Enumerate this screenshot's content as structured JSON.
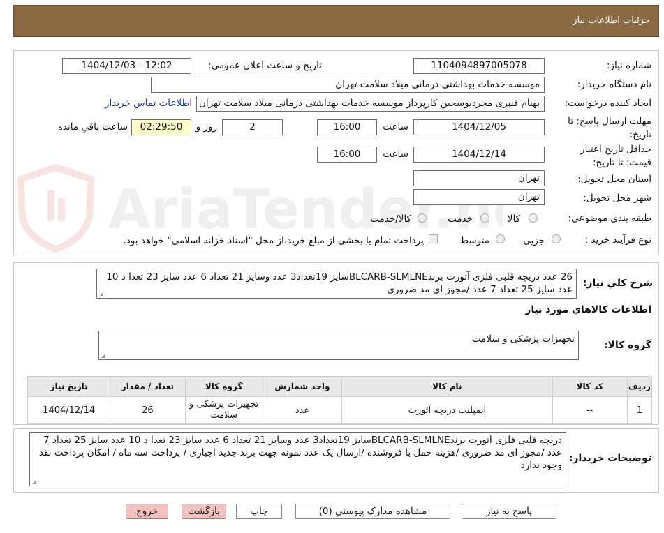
{
  "header": {
    "title": "جزئیات اطلاعات نیاز"
  },
  "form": {
    "need_number_label": "شماره نیاز:",
    "need_number": "1104094897005078",
    "announce_label": "تاریخ و ساعت اعلان عمومی:",
    "announce_value": "1404/12/03 - 12:02",
    "buyer_org_label": "نام دستگاه خریدار:",
    "buyer_org": "موسسه خدمات بهداشتی درمانی میلاد سلامت تهران",
    "creator_label": "ایجاد کننده درخواست:",
    "creator": "بهنام قنبری مجردبوسجین کارپرداز موسسه خدمات بهداشتی درمانی میلاد سلامت تهران",
    "contact_link": "اطلاعات تماس خریدار",
    "deadline_label": "مهلت ارسال پاسخ: تا تاریخ:",
    "deadline_date": "1404/12/05",
    "time_label": "ساعت",
    "deadline_time": "16:00",
    "days_value": "2",
    "days_label": "روز و",
    "remaining_time": "02:29:50",
    "remaining_label": "ساعت باقي مانده",
    "validity_label": "حداقل تاریخ اعتبار قیمت: تا تاریخ:",
    "validity_date": "1404/12/14",
    "validity_time": "16:00",
    "province_label": "استان محل تحویل:",
    "province": "تهران",
    "city_label": "شهر محل تحویل:",
    "city": "تهران",
    "category_label": "طبقه بندی موضوعی:",
    "category_options": [
      "کالا",
      "خدمت",
      "کالا/خدمت"
    ],
    "process_label": "نوع فرآیند خرید :",
    "process_options": [
      "جزیی",
      "متوسط"
    ],
    "treasury_note": "پرداخت تمام یا بخشی از مبلغ خرید،از محل \"اسناد خزانه اسلامی\" خواهد بود."
  },
  "summary": {
    "label": "شرح کلي نياز:",
    "text": "26 عدد دریچه قلبی فلزی  آتورت برندBLCARB-SLMLNEسایز  19تعداد3 عدد وسایز 21 تعداد 6  عدد سایز 23 تعدا د 10 عدد سایز 25 تعداد 7 عدد /مجوز ای مد ضروری"
  },
  "goods": {
    "section_title": "اطلاعات کالاهاي مورد نياز",
    "group_label": "گروه کالا:",
    "group_value": "تجهیزات پزشکی و سلامت"
  },
  "table": {
    "headers": [
      "رديف",
      "کد کالا",
      "نام کالا",
      "واحد شمارش",
      "گروه کالا",
      "تعداد / مقدار",
      "تاریخ نیاز"
    ],
    "rows": [
      [
        "1",
        "--",
        "ایمپلنت دریچه آئورت",
        "عدد",
        "تجهیزات پزشکی و سلامت",
        "26",
        "1404/12/14"
      ]
    ]
  },
  "buyer_notes": {
    "label": "توضیحات خریدار:",
    "text": "دریچه قلبی فلزی  آتورت برندBLCARB-SLMLNEسایز  19تعداد3 عدد وسایز 21 تعداد 6  عدد سایز 23 تعدا د 10 عدد سایز 25 تعداد 7 عدد /مجوز ای مد ضروری /هزینه حمل با فروشنده /ارسال یک عدد نمونه جهت برند جدید اجباری / پرداخت سه ماه / امکان پرداخت نقد وجود ندارد"
  },
  "buttons": {
    "reply": "پاسخ به نیاز",
    "attachments": "مشاهده مدارک پیوستي (0)",
    "print": "چاپ",
    "back": "بازگشت",
    "exit": "خروج"
  },
  "watermark": {
    "text": "AriaTender.neT"
  },
  "colors": {
    "header_bg": "#8b6a43",
    "link": "#1a3fa0",
    "remaining_bg": "#ffffcc",
    "pink_button": "#f5c0c0"
  }
}
